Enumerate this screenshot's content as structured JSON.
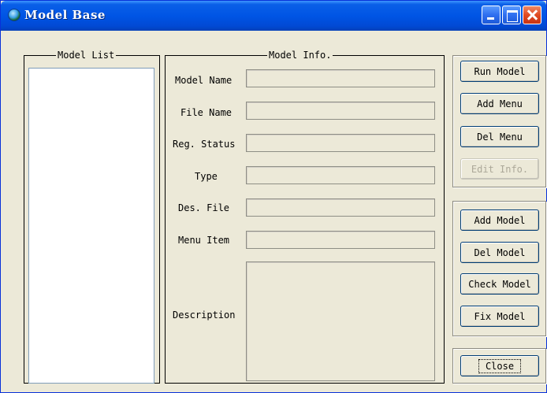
{
  "window": {
    "title": "Model Base",
    "controls": {
      "minimize": "minimize",
      "maximize": "maximize",
      "close": "close"
    }
  },
  "model_list": {
    "title": "Model List",
    "items": []
  },
  "model_info": {
    "title": "Model Info.",
    "fields": [
      {
        "label": "Model Name",
        "value": ""
      },
      {
        "label": "File Name",
        "value": ""
      },
      {
        "label": "Reg. Status",
        "value": ""
      },
      {
        "label": "Type",
        "value": ""
      },
      {
        "label": "Des. File",
        "value": ""
      },
      {
        "label": "Menu Item",
        "value": ""
      },
      {
        "label": "Description",
        "value": ""
      }
    ]
  },
  "actions_top": {
    "run_model": "Run Model",
    "add_menu": "Add Menu",
    "del_menu": "Del Menu",
    "edit_info": "Edit Info."
  },
  "actions_bottom": {
    "add_model": "Add Model",
    "del_model": "Del Model",
    "check_model": "Check Model",
    "fix_model": "Fix Model"
  },
  "close_button": "Close",
  "colors": {
    "titlebar": "#0055e5",
    "window_face": "#ece9d8",
    "disabled_text": "#aca899"
  }
}
